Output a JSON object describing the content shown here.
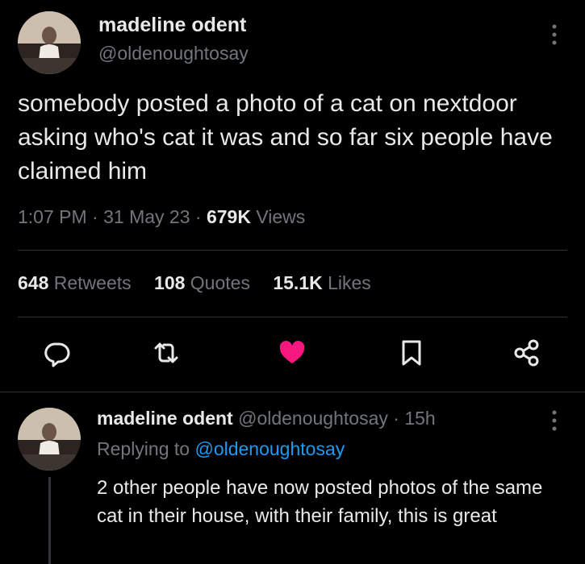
{
  "tweet": {
    "author_name": "madeline odent",
    "author_handle": "@oldenoughtosay",
    "text": "somebody posted a photo of a cat on nextdoor asking who's cat it was and so far six people have claimed him",
    "time": "1:07 PM",
    "date": "31 May 23",
    "separator": "·",
    "views_count": "679K",
    "views_label": "Views",
    "retweets_count": "648",
    "retweets_label": "Retweets",
    "quotes_count": "108",
    "quotes_label": "Quotes",
    "likes_count": "15.1K",
    "likes_label": "Likes",
    "more_icon": "more-vertical-icon"
  },
  "actions": [
    {
      "name": "reply",
      "icon": "comment-icon"
    },
    {
      "name": "retweet",
      "icon": "retweet-icon"
    },
    {
      "name": "like",
      "icon": "heart-icon",
      "active": true
    },
    {
      "name": "bookmark",
      "icon": "bookmark-icon"
    },
    {
      "name": "share",
      "icon": "share-icon"
    }
  ],
  "reply": {
    "author_name": "madeline odent",
    "author_handle": "@oldenoughtosay",
    "separator": "·",
    "age": "15h",
    "replying_to_label": "Replying to",
    "replying_to_handle": "@oldenoughtosay",
    "text": "2 other people have now posted photos of the same cat in their house, with their family, this is great"
  },
  "colors": {
    "background": "#000000",
    "text_primary": "#e7e9ea",
    "text_secondary": "#71767b",
    "link": "#1d9bf0",
    "like_active": "#f91880",
    "divider": "#2f3336"
  }
}
